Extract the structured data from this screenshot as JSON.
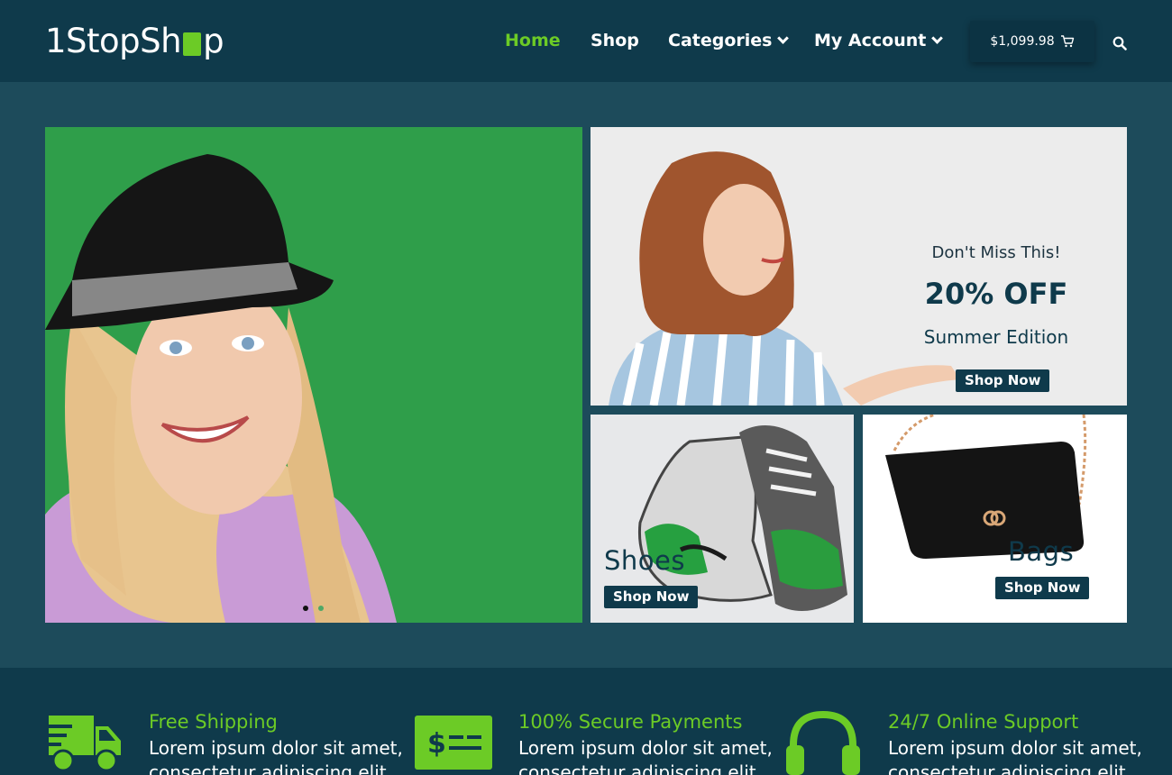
{
  "header": {
    "logo": {
      "text_before": "1StopSh",
      "text_after": "p"
    },
    "nav": [
      {
        "label": "Home",
        "active": true,
        "dropdown": false
      },
      {
        "label": "Shop",
        "active": false,
        "dropdown": false
      },
      {
        "label": "Categories",
        "active": false,
        "dropdown": true
      },
      {
        "label": "My Account",
        "active": false,
        "dropdown": true
      }
    ],
    "cart": {
      "total": "$1,099.98",
      "icon": "cart-icon"
    },
    "search_icon": "search-icon"
  },
  "hero": {
    "main": {
      "carousel_dots": 2,
      "active_dot": 0
    },
    "promo": {
      "kicker": "Don't Miss This!",
      "headline": "20% OFF",
      "subhead": "Summer Edition",
      "button": "Shop Now"
    },
    "shoes": {
      "label": "Shoes",
      "button": "Shop Now"
    },
    "bags": {
      "label": "Bags",
      "button": "Shop Now"
    }
  },
  "features": [
    {
      "icon": "delivery-truck-icon",
      "title": "Free Shipping",
      "desc_line1": "Lorem ipsum dolor sit amet,",
      "desc_line2": "consectetur adipiscing elit."
    },
    {
      "icon": "payment-card-icon",
      "title": "100% Secure Payments",
      "desc_line1": "Lorem ipsum dolor sit amet,",
      "desc_line2": "consectetur adipiscing elit."
    },
    {
      "icon": "headphones-icon",
      "title": "24/7 Online Support",
      "desc_line1": "Lorem ipsum dolor sit amet,",
      "desc_line2": "consectetur adipiscing elit."
    }
  ],
  "colors": {
    "brand_green": "#6ccb26",
    "header_bg": "#0f3a4b",
    "page_bg": "#1d4b5b"
  }
}
